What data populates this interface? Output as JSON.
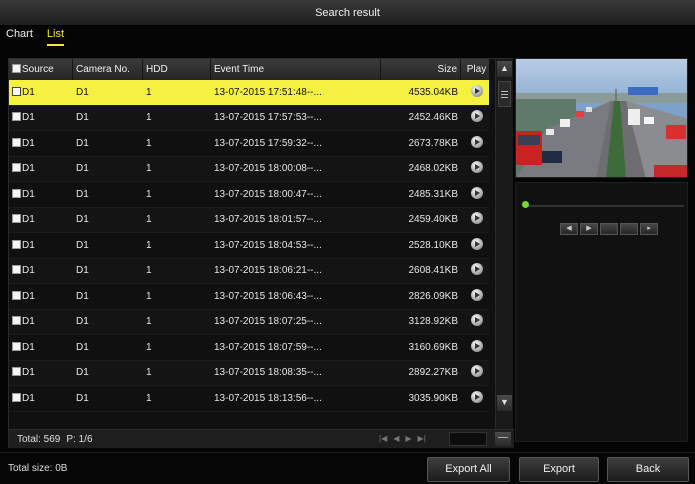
{
  "window": {
    "title": "Search result"
  },
  "tabs": [
    {
      "label": "Chart",
      "active": false
    },
    {
      "label": "List",
      "active": true
    }
  ],
  "table": {
    "headers": {
      "source": "Source",
      "camera": "Camera No.",
      "hdd": "HDD",
      "time": "Event Time",
      "size": "Size",
      "play": "Play"
    },
    "rows": [
      {
        "source": "D1",
        "camera": "D1",
        "hdd": "1",
        "time": "13-07-2015 17:51:48--...",
        "size": "4535.04KB",
        "selected": true
      },
      {
        "source": "D1",
        "camera": "D1",
        "hdd": "1",
        "time": "13-07-2015 17:57:53--...",
        "size": "2452.46KB"
      },
      {
        "source": "D1",
        "camera": "D1",
        "hdd": "1",
        "time": "13-07-2015 17:59:32--...",
        "size": "2673.78KB"
      },
      {
        "source": "D1",
        "camera": "D1",
        "hdd": "1",
        "time": "13-07-2015 18:00:08--...",
        "size": "2468.02KB"
      },
      {
        "source": "D1",
        "camera": "D1",
        "hdd": "1",
        "time": "13-07-2015 18:00:47--...",
        "size": "2485.31KB"
      },
      {
        "source": "D1",
        "camera": "D1",
        "hdd": "1",
        "time": "13-07-2015 18:01:57--...",
        "size": "2459.40KB"
      },
      {
        "source": "D1",
        "camera": "D1",
        "hdd": "1",
        "time": "13-07-2015 18:04:53--...",
        "size": "2528.10KB"
      },
      {
        "source": "D1",
        "camera": "D1",
        "hdd": "1",
        "time": "13-07-2015 18:06:21--...",
        "size": "2608.41KB"
      },
      {
        "source": "D1",
        "camera": "D1",
        "hdd": "1",
        "time": "13-07-2015 18:06:43--...",
        "size": "2826.09KB"
      },
      {
        "source": "D1",
        "camera": "D1",
        "hdd": "1",
        "time": "13-07-2015 18:07:25--...",
        "size": "3128.92KB"
      },
      {
        "source": "D1",
        "camera": "D1",
        "hdd": "1",
        "time": "13-07-2015 18:07:59--...",
        "size": "3160.69KB"
      },
      {
        "source": "D1",
        "camera": "D1",
        "hdd": "1",
        "time": "13-07-2015 18:08:35--...",
        "size": "2892.27KB"
      },
      {
        "source": "D1",
        "camera": "D1",
        "hdd": "1",
        "time": "13-07-2015 18:13:56--...",
        "size": "3035.90KB"
      }
    ]
  },
  "footer": {
    "total": "Total: 569",
    "page": "P: 1/6"
  },
  "pager_icons": [
    "first-page-icon",
    "prev-page-icon",
    "next-page-icon",
    "last-page-icon"
  ],
  "preview": {
    "description_icon": "video-preview-thumbnail"
  },
  "bottom": {
    "total_size": "Total size: 0B",
    "export_all": "Export All",
    "export": "Export",
    "back": "Back"
  },
  "colors": {
    "selected_row": "#f4f141",
    "active_tab": "#f5e52b",
    "progress_dot": "#6fdc2c"
  }
}
